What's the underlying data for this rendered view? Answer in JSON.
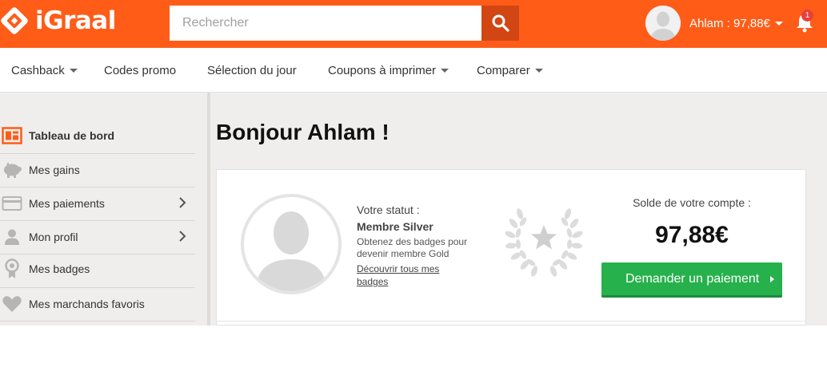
{
  "header": {
    "logo_text": "iGraal",
    "search_placeholder": "Rechercher",
    "user_label": "Ahlam : 97,88€",
    "notification_count": "1",
    "brand_color": "#ff5c18"
  },
  "nav": {
    "items": [
      {
        "label": "Cashback",
        "has_dropdown": true
      },
      {
        "label": "Codes promo",
        "has_dropdown": false
      },
      {
        "label": "Sélection du jour",
        "has_dropdown": false
      },
      {
        "label": "Coupons à imprimer",
        "has_dropdown": true
      },
      {
        "label": "Comparer",
        "has_dropdown": true
      }
    ]
  },
  "sidebar": {
    "items": [
      {
        "label": "Tableau de bord",
        "icon": "dashboard-icon",
        "active": true
      },
      {
        "label": "Mes gains",
        "icon": "piggy-bank-icon",
        "active": false
      },
      {
        "label": "Mes paiements",
        "icon": "credit-card-icon",
        "active": false,
        "has_arrow": true
      },
      {
        "label": "Mon profil",
        "icon": "user-icon",
        "active": false,
        "has_arrow": true
      },
      {
        "label": "Mes badges",
        "icon": "badge-icon",
        "active": false
      },
      {
        "label": "Mes marchands favoris",
        "icon": "heart-icon",
        "active": false
      }
    ]
  },
  "main": {
    "greeting": "Bonjour Ahlam !",
    "status": {
      "label": "Votre statut :",
      "value": "Membre Silver",
      "description": "Obtenez des badges pour devenir membre Gold",
      "link": "Découvrir tous mes badges"
    },
    "balance": {
      "label": "Solde de votre compte :",
      "value": "97,88€",
      "button_label": "Demander un paiement",
      "button_color": "#27b14c"
    }
  }
}
